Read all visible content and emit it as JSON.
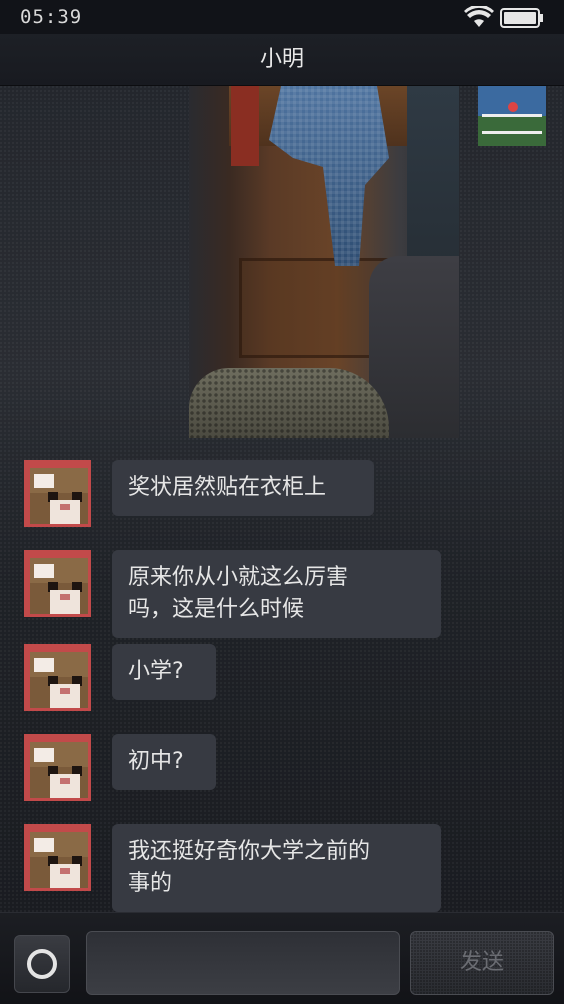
{
  "status_bar": {
    "time": "05:39",
    "wifi_icon": "wifi-icon",
    "battery_icon": "battery-icon"
  },
  "header": {
    "title": "小明"
  },
  "messages": [
    {
      "sender": "contact",
      "text": "奖状居然贴在衣柜上"
    },
    {
      "sender": "contact",
      "text": "原来你从小就这么厉害\n吗，这是什么时候"
    },
    {
      "sender": "contact",
      "text": "小学?"
    },
    {
      "sender": "contact",
      "text": "初中?"
    },
    {
      "sender": "contact",
      "text": "我还挺好奇你大学之前的\n事的"
    }
  ],
  "input_bar": {
    "camera_icon": "camera-icon",
    "input_value": "",
    "send_label": "发送"
  }
}
